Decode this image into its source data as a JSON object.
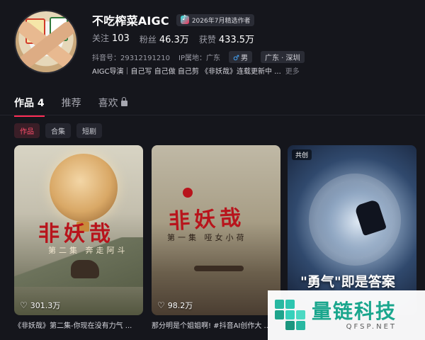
{
  "profile": {
    "name": "不吃榨菜AIGC",
    "badge": "2026年7月精选作者",
    "stats": [
      {
        "label": "关注",
        "value": "103"
      },
      {
        "label": "粉丝",
        "value": "46.3万"
      },
      {
        "label": "获赞",
        "value": "433.5万"
      }
    ],
    "douyin_id": "抖音号：29312191210",
    "ip": "IP属地：广东",
    "gender": "男",
    "region": "广东 · 深圳",
    "bio": "AIGC导演｜自己写 自己做 自己剪 《非妖哉》连载更新中 ...",
    "bio_more": "更多"
  },
  "tabs": [
    {
      "label": "作品 4",
      "active": true
    },
    {
      "label": "推荐",
      "active": false
    },
    {
      "label": "喜欢",
      "active": false,
      "locked": true
    }
  ],
  "filters": [
    "作品",
    "合集",
    "短剧"
  ],
  "cards": [
    {
      "title_art": "非妖哉",
      "subtitle_art": "第二集 奔走阿斗",
      "likes": "301.3万",
      "caption": "《非妖哉》第二集-你现在没有力气 ..."
    },
    {
      "title_art": "非妖哉",
      "subtitle_art": "第一集 哑女小荷",
      "likes": "98.2万",
      "caption": "那分明是个姐姐啊! #抖音AI创作大 ..."
    },
    {
      "tag": "共创",
      "slogan": "\"勇气\"即是答案"
    }
  ],
  "watermark": {
    "title": "量链科技",
    "url": "QFSP.NET"
  },
  "colors": {
    "background": "#15161c",
    "accent": "#fe2c55",
    "watermark": "#1aa68d"
  }
}
